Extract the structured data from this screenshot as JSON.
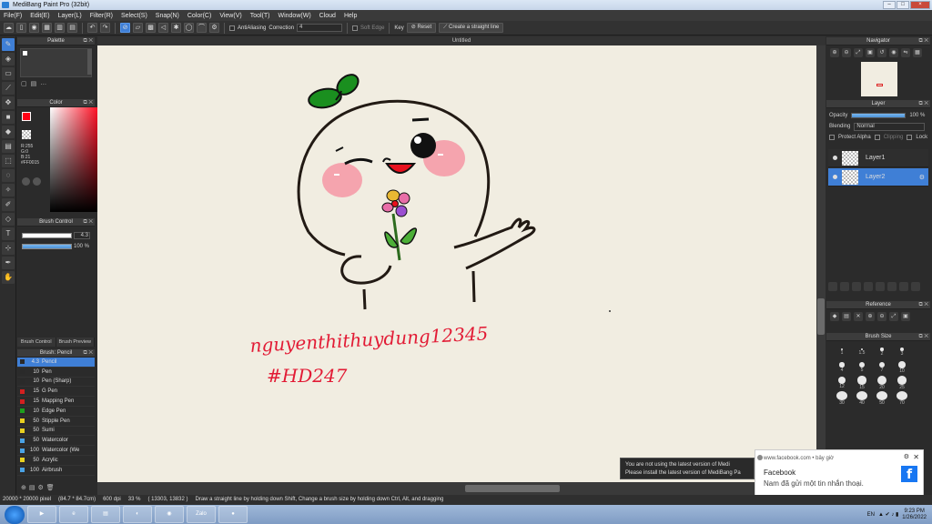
{
  "app": {
    "title": "MediBang Paint Pro (32bit)",
    "window_controls": [
      "–",
      "□",
      "×"
    ]
  },
  "menu": [
    "File(F)",
    "Edit(E)",
    "Layer(L)",
    "Filter(R)",
    "Select(S)",
    "Snap(N)",
    "Color(C)",
    "View(V)",
    "Tool(T)",
    "Window(W)",
    "Cloud",
    "Help"
  ],
  "toolbar": {
    "antialiasing_label": "AntiAliasing",
    "correction_label": "Correction",
    "correction_value": "4",
    "soft_edge_label": "Soft Edge",
    "key_label": "Key",
    "reset_label": "Reset",
    "straight_line_label": "Create a straight line"
  },
  "palette": {
    "title": "Palette",
    "foot": [
      "▢",
      "▤",
      "…"
    ]
  },
  "color": {
    "title": "Color",
    "r": "R:255",
    "g": "G:0",
    "b": "B:21",
    "hex": "#FF0015",
    "fg_color": "#ff0015"
  },
  "brush_control": {
    "title": "Brush Control",
    "size_value": "4.3",
    "opacity_value": "100 %",
    "opacity_level": 1.0
  },
  "brush_tabs": [
    "Brush Control",
    "Brush Preview"
  ],
  "brush_list": {
    "title": "Brush: Pencil",
    "items": [
      {
        "size": "4.3",
        "name": "Pencil",
        "color": "#2a2a2a"
      },
      {
        "size": "10",
        "name": "Pen",
        "color": "#2a2a2a"
      },
      {
        "size": "10",
        "name": "Pen (Sharp)",
        "color": "#2a2a2a"
      },
      {
        "size": "15",
        "name": "G Pen",
        "color": "#d42020"
      },
      {
        "size": "15",
        "name": "Mapping Pen",
        "color": "#d42020"
      },
      {
        "size": "10",
        "name": "Edge Pen",
        "color": "#1ea01e"
      },
      {
        "size": "50",
        "name": "Stipple Pen",
        "color": "#e8d020"
      },
      {
        "size": "50",
        "name": "Sumi",
        "color": "#e8d020"
      },
      {
        "size": "50",
        "name": "Watercolor",
        "color": "#4aa3e6"
      },
      {
        "size": "100",
        "name": "Watercolor (We",
        "color": "#4aa3e6"
      },
      {
        "size": "50",
        "name": "Acrylic",
        "color": "#e8d020"
      },
      {
        "size": "100",
        "name": "Airbrush",
        "color": "#4aa3e6"
      }
    ]
  },
  "canvas": {
    "tab_title": "Untitled",
    "handwriting_line1": "nguyenthithuydung12345",
    "handwriting_line2": "#HD247"
  },
  "navigator": {
    "title": "Navigator"
  },
  "layer_panel": {
    "title": "Layer",
    "opacity_label": "Opacity",
    "opacity_value": "100 %",
    "blending_label": "Blending",
    "blending_value": "Normal",
    "protect_alpha": "Protect Alpha",
    "clipping": "Clipping",
    "lock": "Lock",
    "layers": [
      "Layer1",
      "Layer2"
    ]
  },
  "reference": {
    "title": "Reference"
  },
  "brush_size": {
    "title": "Brush Size",
    "values": [
      "1",
      "1.5",
      "2",
      "3",
      "4",
      "5",
      "7",
      "10",
      "12",
      "15",
      "20",
      "25",
      "30",
      "40",
      "50",
      "70"
    ]
  },
  "status": {
    "size": "20000 * 20000 pixel",
    "cm": "(84.7 * 84.7cm)",
    "dpi": "600 dpi",
    "zoom": "33 %",
    "coords": "( 13303, 13832 )",
    "hint": "Draw a straight line by holding down Shift, Change a brush size by holding down Ctrl, Alt, and dragging"
  },
  "update_notice": {
    "line1": "You are not using the latest version of Medi",
    "line2": "Please install the latest version of MediBang Pa"
  },
  "facebook_toast": {
    "source": "www.facebook.com • bây giờ",
    "title": "Facebook",
    "message": "Nam đã gửi một tin nhắn thoại.",
    "logo": "f"
  },
  "taskbar": {
    "apps": [
      "Zalo"
    ],
    "lang": "EN",
    "time": "9:23 PM",
    "date": "1/26/2022"
  }
}
